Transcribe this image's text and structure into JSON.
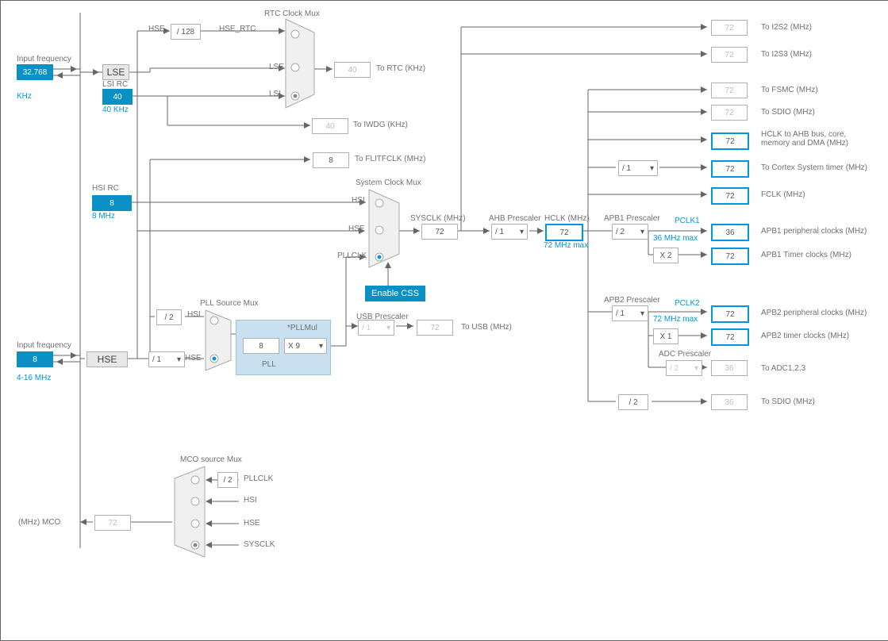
{
  "inputs": {
    "lse": {
      "title": "Input frequency",
      "value": "32.768",
      "unit": "KHz",
      "range": ""
    },
    "hse": {
      "title": "Input frequency",
      "value": "8",
      "unit": "",
      "range": "4-16 MHz"
    }
  },
  "sources": {
    "lse_label": "LSE",
    "lsi_rc_title": "LSI RC",
    "lsi_rc_value": "40",
    "lsi_rc_note": "40 KHz",
    "hsi_rc_title": "HSI RC",
    "hsi_rc_value": "8",
    "hsi_rc_note": "8 MHz",
    "hse_label": "HSE"
  },
  "rtc": {
    "title": "RTC Clock Mux",
    "divider": "/ 128",
    "hse_rtc": "HSE_RTC",
    "lse": "LSE",
    "lsi": "LSI",
    "rtc_value": "40",
    "rtc_label": "To RTC (KHz)",
    "iwdg_value": "40",
    "iwdg_label": "To IWDG (KHz)"
  },
  "flitf": {
    "value": "8",
    "label": "To FLITFCLK (MHz)"
  },
  "sys_mux": {
    "title": "System Clock Mux",
    "hsi": "HSI",
    "hse": "HSE",
    "pllclk": "PLLCLK"
  },
  "enable_css": "Enable CSS",
  "pll": {
    "title": "PLL Source Mux",
    "div2": "/ 2",
    "hsi": "HSI",
    "hse": "HSE",
    "hse_div": "/ 1",
    "value": "8",
    "mul_label": "*PLLMul",
    "mul": "X 9",
    "pll_label": "PLL"
  },
  "usb": {
    "title": "USB Prescaler",
    "div": "/ 1",
    "value": "72",
    "label": "To USB (MHz)"
  },
  "sysclk": {
    "label": "SYSCLK (MHz)",
    "value": "72"
  },
  "ahb": {
    "label": "AHB Prescaler",
    "div": "/ 1"
  },
  "hclk": {
    "label": "HCLK (MHz)",
    "value": "72",
    "note": "72 MHz max"
  },
  "i2s2": {
    "value": "72",
    "label": "To I2S2 (MHz)"
  },
  "i2s3": {
    "value": "72",
    "label": "To I2S3 (MHz)"
  },
  "fsmc": {
    "value": "72",
    "label": "To FSMC (MHz)"
  },
  "sdio1": {
    "value": "72",
    "label": "To SDIO (MHz)"
  },
  "hclk_ahb": {
    "value": "72",
    "label": "HCLK to AHB bus, core, memory and DMA (MHz)"
  },
  "cortex": {
    "div": "/ 1",
    "value": "72",
    "label": "To Cortex System timer (MHz)"
  },
  "fclk": {
    "value": "72",
    "label": "FCLK (MHz)"
  },
  "apb1": {
    "title": "APB1 Prescaler",
    "div": "/ 2",
    "pclk1_label": "PCLK1",
    "pclk1_note": "36 MHz max",
    "periph_value": "36",
    "periph_label": "APB1 peripheral clocks (MHz)",
    "timer_mul": "X 2",
    "timer_value": "72",
    "timer_label": "APB1 Timer clocks (MHz)"
  },
  "apb2": {
    "title": "APB2 Prescaler",
    "div": "/ 1",
    "pclk2_label": "PCLK2",
    "pclk2_note": "72 MHz max",
    "periph_value": "72",
    "periph_label": "APB2 peripheral clocks (MHz)",
    "timer_mul": "X 1",
    "timer_value": "72",
    "timer_label": "APB2 timer clocks (MHz)",
    "adc_title": "ADC Prescaler",
    "adc_div": "/ 2",
    "adc_value": "36",
    "adc_label": "To ADC1,2,3"
  },
  "sdio2": {
    "div": "/ 2",
    "value": "36",
    "label": "To SDIO (MHz)"
  },
  "mco": {
    "title": "MCO source Mux",
    "div2": "/ 2",
    "opts": {
      "pllclk": "PLLCLK",
      "hsi": "HSI",
      "hse": "HSE",
      "sysclk": "SYSCLK"
    },
    "value": "72",
    "label": "(MHz) MCO"
  }
}
